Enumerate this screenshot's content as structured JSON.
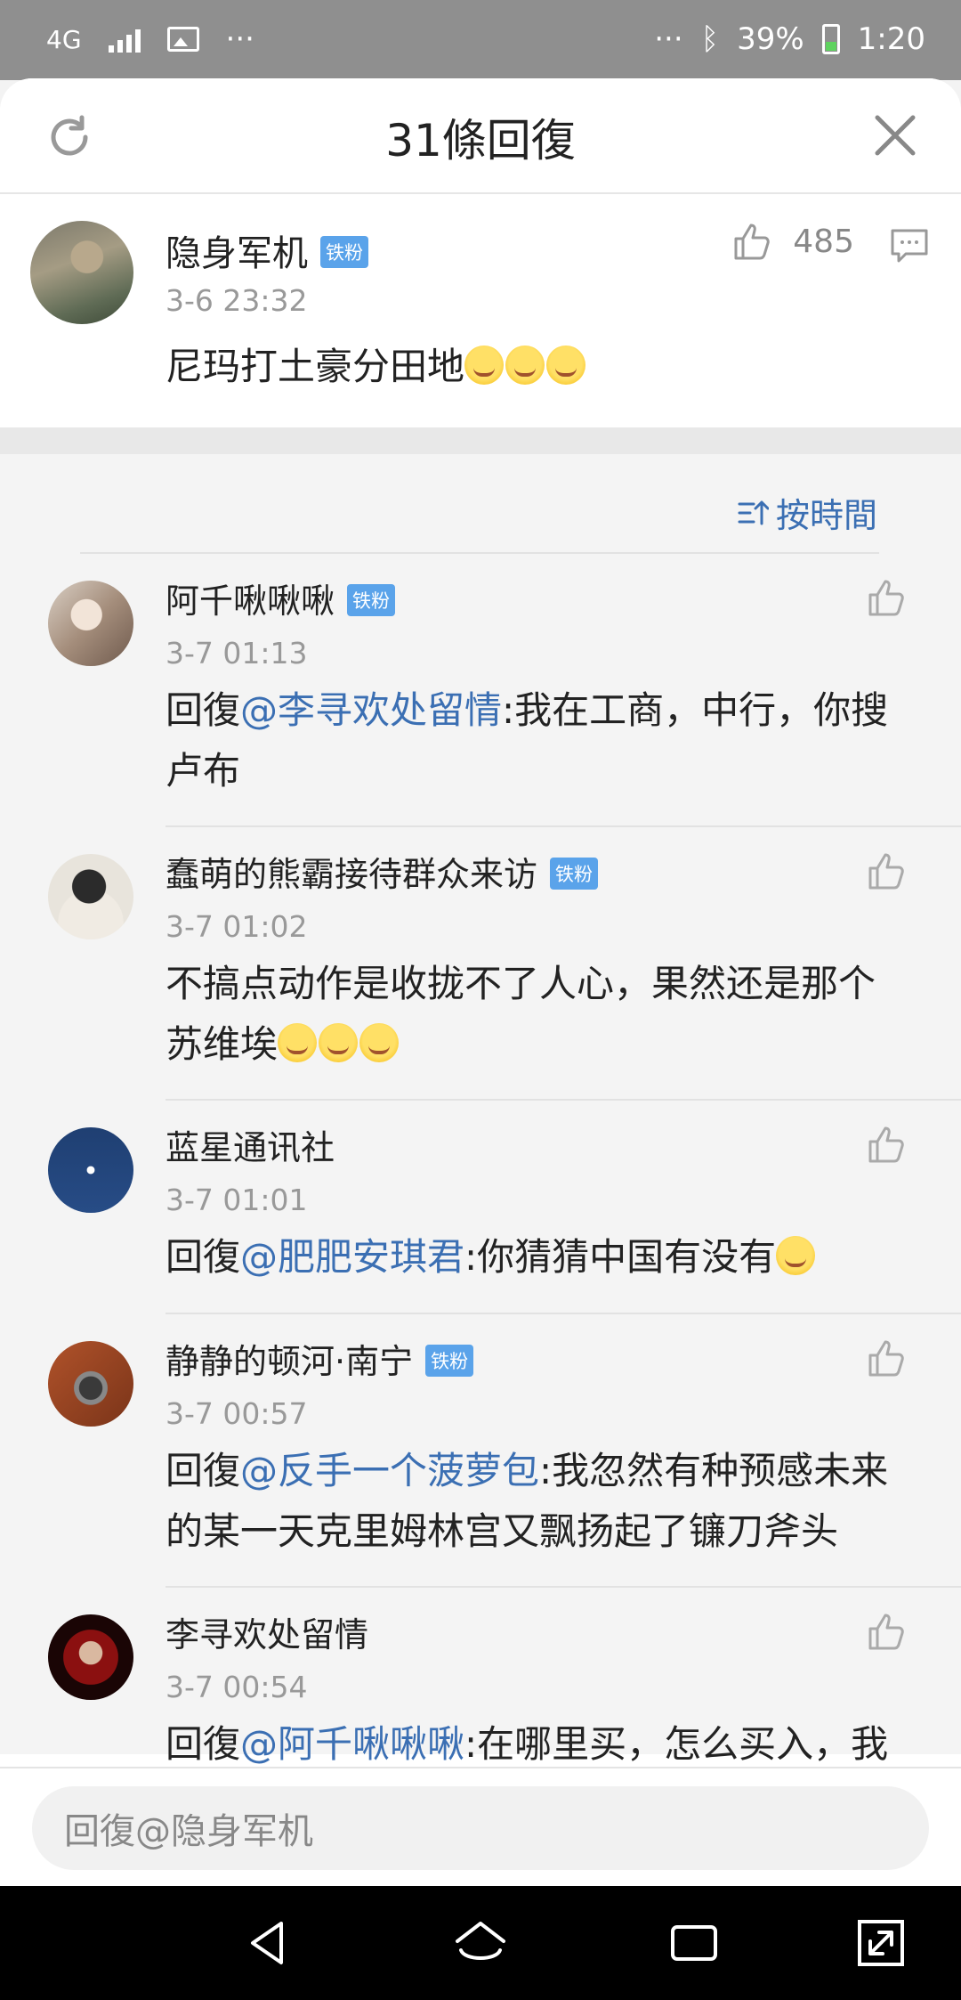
{
  "status_bar": {
    "network": "4G",
    "more_left": "···",
    "more_right": "···",
    "battery": "39%",
    "time": "1:20"
  },
  "header": {
    "title": "31條回復"
  },
  "main_comment": {
    "username": "隐身军机",
    "badge": "铁粉",
    "time": "3-6 23:32",
    "text": "尼玛打土豪分田地",
    "likes": "485"
  },
  "sort": {
    "label": "按時間"
  },
  "replies": [
    {
      "username": "阿千啾啾啾",
      "badge": "铁粉",
      "time": "3-7 01:13",
      "prefix": "回復",
      "mention": "@李寻欢处留情",
      "text": ":我在工商，中行，你搜卢布"
    },
    {
      "username": "蠢萌的熊霸接待群众来访",
      "badge": "铁粉",
      "time": "3-7 01:02",
      "text": "不搞点动作是收拢不了人心，果然还是那个苏维埃"
    },
    {
      "username": "蓝星通讯社",
      "time": "3-7 01:01",
      "prefix": "回復",
      "mention": "@肥肥安琪君",
      "text": ":你猜猜中国有没有"
    },
    {
      "username": "静静的顿河·南宁",
      "badge": "铁粉",
      "time": "3-7 00:57",
      "prefix": "回復",
      "mention": "@反手一个菠萝包",
      "text": ":我忽然有种预感未来的某一天克里姆林宫又飘扬起了镰刀斧头"
    },
    {
      "username": "李寻欢处留情",
      "time": "3-7 00:54",
      "prefix": "回復",
      "mention": "@阿千啾啾啾",
      "text": ":在哪里买，怎么买入，我"
    }
  ],
  "input": {
    "placeholder": "回復@隐身军机"
  },
  "colors": {
    "link": "#3b6fb3",
    "badge": "#5aa3ea",
    "status_bar": "#8f8f8f"
  }
}
